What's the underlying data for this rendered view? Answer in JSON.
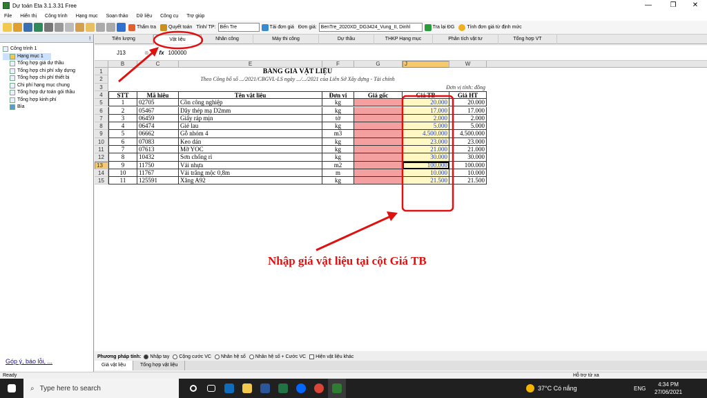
{
  "window": {
    "title": "Dự toán Eta 3.1.3.31 Free",
    "minimize": "—",
    "maximize": "❐",
    "close": "✕"
  },
  "menu": [
    "File",
    "Hiển thị",
    "Công trình",
    "Hạng mục",
    "Soạn thảo",
    "Dữ liệu",
    "Công cụ",
    "Trợ giúp"
  ],
  "toolbar": {
    "tham_tra": "Thẩm tra",
    "quyet_toan": "Quyết toán",
    "tinh_label": "Tỉnh/ TP:",
    "tinh_value": "Bến Tre",
    "tai_don_gia": "Tải đơn giá",
    "don_gia_label": "Đơn giá:",
    "don_gia_value": "BenTre_2020XD_DG3424_Vung_II, Dinhl",
    "tra_lai_dg": "Tra lại ĐG",
    "tinh_don_gia": "Tính đơn giá từ định mức"
  },
  "tree": [
    "Công trình 1",
    "Hạng mục 1",
    "Tổng hợp giá dự thầu",
    "Tổng hợp chi phí xây dựng",
    "Tổng hợp chi phí thiết bị",
    "Chi phí hạng mục chung",
    "Tổng hợp dự toán gói thầu",
    "Tổng hợp kinh phí",
    "Bìa"
  ],
  "feedback": "Góp ý, báo lỗi, ...",
  "tabs": [
    "Tiên lượng",
    "Vật liệu",
    "Nhân công",
    "Máy thi công",
    "Dự thầu",
    "THKP Hạng mục",
    "Phân tích vật tư",
    "Tổng hợp VT"
  ],
  "formula": {
    "cell_ref": "J13",
    "fx": "fx",
    "value": "100000"
  },
  "columns": [
    "B",
    "C",
    "E",
    "F",
    "G",
    "J",
    "W"
  ],
  "rows": [
    "1",
    "2",
    "3",
    "4",
    "5",
    "6",
    "7",
    "8",
    "9",
    "10",
    "11",
    "12",
    "13",
    "14",
    "15"
  ],
  "sheet": {
    "title": "BẢNG GIÁ VẬT LIỆU",
    "subtitle": "Theo Công bố số .../2021/CBGVL-LS ngày .../.../2021 của Liên Sở Xây dựng - Tài chính",
    "unit": "Đơn vị tính: đồng",
    "headers": [
      "STT",
      "Mã hiệu",
      "Tên vật liệu",
      "Đơn vị",
      "Giá gốc",
      "Giá TB",
      "Giá HT"
    ],
    "items": [
      [
        "1",
        "02705",
        "Cồn công nghiệp",
        "kg",
        "",
        "20.000",
        "20.000"
      ],
      [
        "2",
        "05467",
        "Dây thép mạ D2mm",
        "kg",
        "",
        "17.000",
        "17.000"
      ],
      [
        "3",
        "06459",
        "Giấy ráp mịn",
        "tờ",
        "",
        "2.000",
        "2.000"
      ],
      [
        "4",
        "06474",
        "Giẻ lau",
        "kg",
        "",
        "5.000",
        "5.000"
      ],
      [
        "5",
        "06662",
        "Gỗ nhóm 4",
        "m3",
        "",
        "4.500.000",
        "4.500.000"
      ],
      [
        "6",
        "07083",
        "Keo dán",
        "kg",
        "",
        "23.000",
        "23.000"
      ],
      [
        "7",
        "07613",
        "Mỡ YOC",
        "kg",
        "",
        "21.000",
        "21.000"
      ],
      [
        "8",
        "10432",
        "Sơn chống rỉ",
        "kg",
        "",
        "30.000",
        "30.000"
      ],
      [
        "9",
        "11750",
        "Vải nhựa",
        "m2",
        "",
        "100.000",
        "100.000"
      ],
      [
        "10",
        "11767",
        "Vải trắng mộc 0,8m",
        "m",
        "",
        "10.000",
        "10.000"
      ],
      [
        "11",
        "125591",
        "Xăng A92",
        "kg",
        "",
        "21.500",
        "21.500"
      ]
    ]
  },
  "method": {
    "label": "Phương pháp tính:",
    "options": [
      "Nhập tay",
      "Cộng cước VC",
      "Nhân hệ số",
      "Nhân hệ số + Cước VC"
    ],
    "checkbox": "Hiện vật liệu khác"
  },
  "bottom_tabs": [
    "Giá vật liệu",
    "Tổng hợp vật liệu"
  ],
  "status": "Ready",
  "help": "Hỗ trợ từ xa",
  "annotation": "Nhập giá vật liệu tại cột Giá TB",
  "taskbar": {
    "search": "Type here to search",
    "weather": "37°C Có nắng",
    "lang": "ENG",
    "time": "4:34 PM",
    "date": "27/06/2021"
  }
}
